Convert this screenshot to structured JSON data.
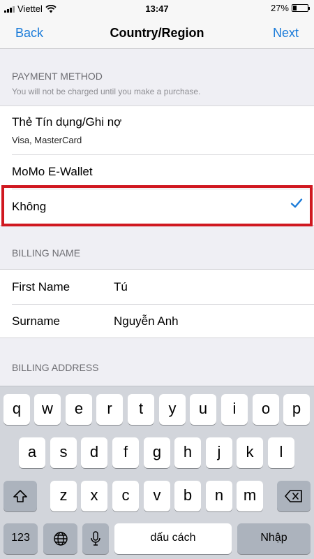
{
  "status_bar": {
    "carrier": "Viettel",
    "time": "13:47",
    "battery_percent": "27%",
    "battery_level": 0.27,
    "icons": [
      "signal-icon",
      "wifi-icon",
      "battery-icon"
    ]
  },
  "nav": {
    "back_label": "Back",
    "title": "Country/Region",
    "next_label": "Next"
  },
  "payment_method": {
    "header": "PAYMENT METHOD",
    "subtitle": "You will not be charged until you make a purchase.",
    "options": [
      {
        "title": "Thẻ Tín dụng/Ghi nợ",
        "detail": "Visa, MasterCard",
        "selected": false
      },
      {
        "title": "MoMo E-Wallet",
        "selected": false
      },
      {
        "title": "Không",
        "selected": true
      }
    ]
  },
  "billing_name": {
    "header": "BILLING NAME",
    "fields": [
      {
        "label": "First Name",
        "value": "Tú"
      },
      {
        "label": "Surname",
        "value": "Nguyễn Anh"
      }
    ]
  },
  "billing_address": {
    "header": "BILLING ADDRESS"
  },
  "keyboard": {
    "row1": [
      "q",
      "w",
      "e",
      "r",
      "t",
      "y",
      "u",
      "i",
      "o",
      "p"
    ],
    "row2": [
      "a",
      "s",
      "d",
      "f",
      "g",
      "h",
      "j",
      "k",
      "l"
    ],
    "row3": [
      "z",
      "x",
      "c",
      "v",
      "b",
      "n",
      "m"
    ],
    "numbers_label": "123",
    "space_label": "dấu cách",
    "return_label": "Nhập"
  },
  "colors": {
    "accent": "#1a7bd9",
    "highlight_border": "#d01820",
    "keyboard_bg": "#d2d5db"
  }
}
